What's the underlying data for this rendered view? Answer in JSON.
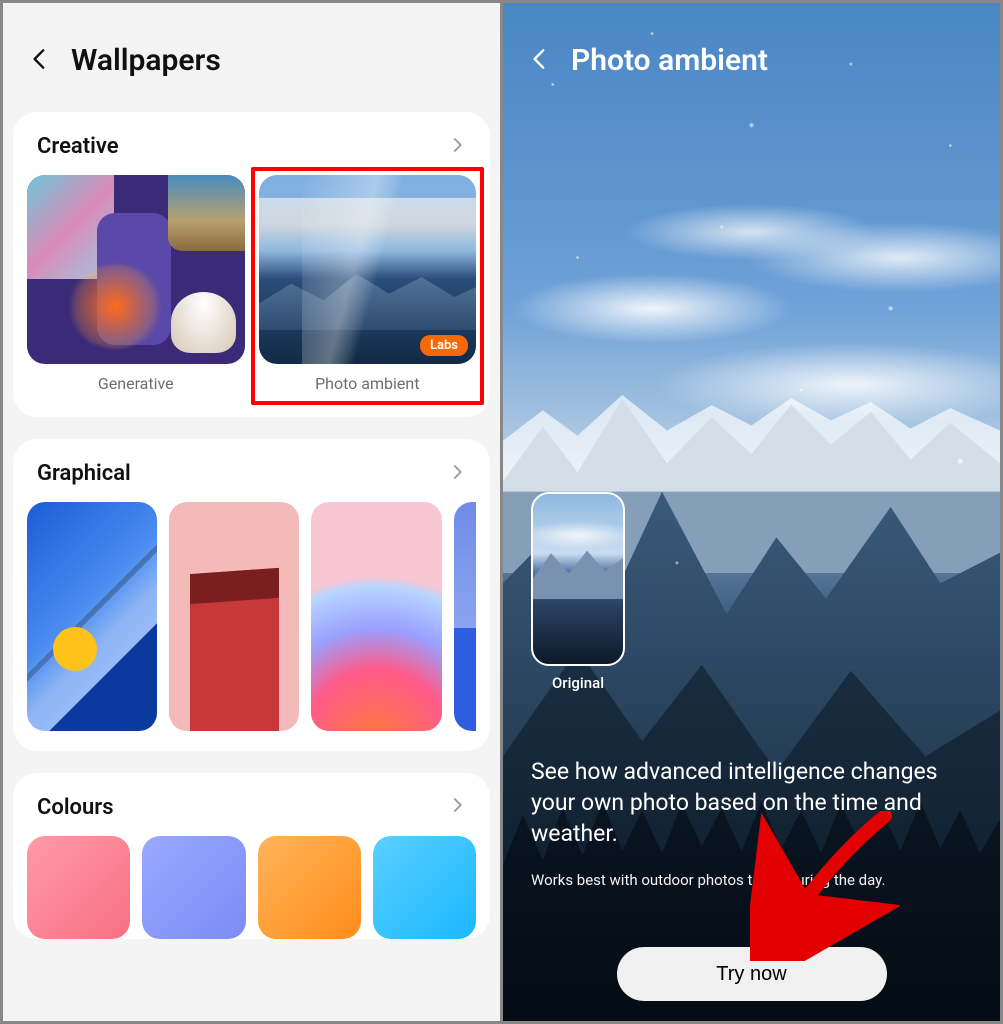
{
  "left": {
    "title": "Wallpapers",
    "sections": {
      "creative": {
        "title": "Creative",
        "items": [
          {
            "label": "Generative"
          },
          {
            "label": "Photo ambient",
            "badge": "Labs"
          }
        ]
      },
      "graphical": {
        "title": "Graphical"
      },
      "colours": {
        "title": "Colours"
      }
    }
  },
  "right": {
    "title": "Photo ambient",
    "original_label": "Original",
    "description": "See how advanced intelligence changes your own photo based on the time and weather.",
    "hint": "Works best with outdoor photos taken during the day.",
    "cta": "Try now"
  }
}
